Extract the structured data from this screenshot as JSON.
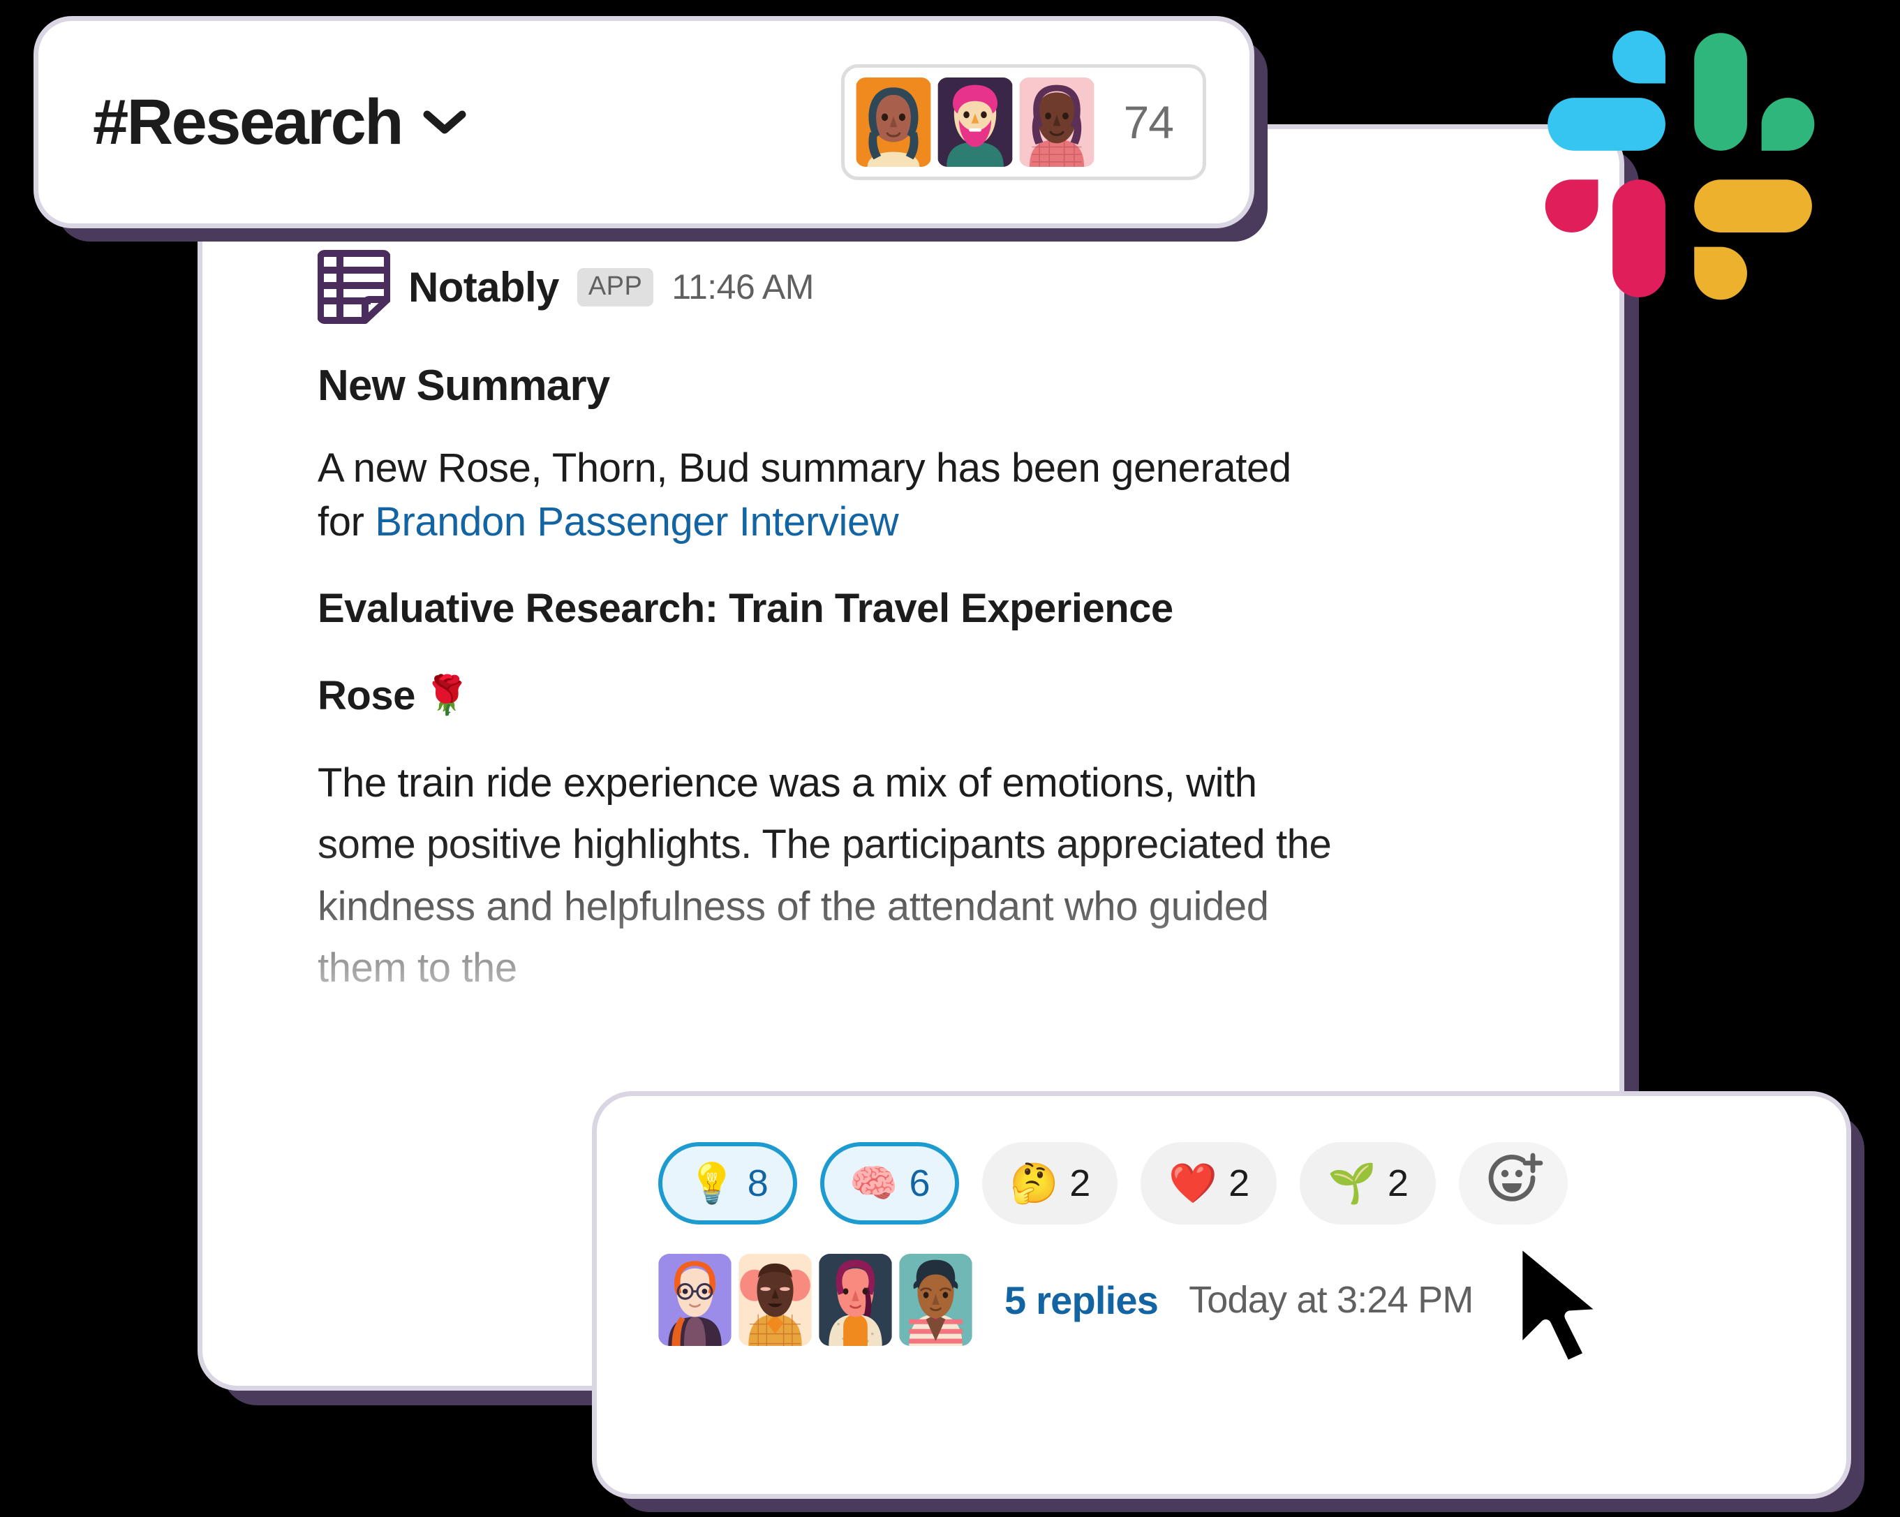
{
  "channel_header": {
    "name": "#Research",
    "chevron_icon": "chevron-down-icon",
    "member_count": "74",
    "member_avatars": [
      {
        "name": "member-avatar-1",
        "bg": "#F08A1E"
      },
      {
        "name": "member-avatar-2",
        "bg": "#3A2647"
      },
      {
        "name": "member-avatar-3",
        "bg": "#F9C8CC"
      }
    ]
  },
  "message": {
    "app_icon": "notably-table-icon",
    "app_name": "Notably",
    "app_badge": "APP",
    "timestamp": "11:46 AM",
    "title": "New Summary",
    "body_prefix": "A new Rose, Thorn, Bud summary has been generated for ",
    "body_link": "Brandon Passenger Interview",
    "subtitle": "Evaluative Research: Train Travel Experience",
    "section_title": "Rose",
    "section_emoji": "🌹",
    "section_body": "The train ride experience was a mix of emotions, with some positive highlights. The participants appreciated the kindness and helpfulness of the attendant who guided them to the"
  },
  "reactions": [
    {
      "name": "reaction-lightbulb",
      "emoji": "💡",
      "count": "8",
      "selected": true
    },
    {
      "name": "reaction-brain",
      "emoji": "🧠",
      "count": "6",
      "selected": true
    },
    {
      "name": "reaction-thinking",
      "emoji": "🤔",
      "count": "2",
      "selected": false
    },
    {
      "name": "reaction-heart",
      "emoji": "❤️",
      "count": "2",
      "selected": false
    },
    {
      "name": "reaction-seedling",
      "emoji": "🌱",
      "count": "2",
      "selected": false
    }
  ],
  "add_reaction": {
    "name": "add-reaction-button",
    "icon": "smiley-plus-icon"
  },
  "thread": {
    "replies_label": "5 replies",
    "timestamp": "Today at 3:24 PM",
    "avatars": [
      {
        "name": "reply-avatar-1",
        "bg": "#9B8CEA"
      },
      {
        "name": "reply-avatar-2",
        "bg": "#FDE6CC"
      },
      {
        "name": "reply-avatar-3",
        "bg": "#2C3E50"
      },
      {
        "name": "reply-avatar-4",
        "bg": "#6FB8B5"
      }
    ]
  },
  "brand": {
    "logo": "slack-logo",
    "colors": {
      "cyan": "#36C5F0",
      "green": "#2EB67D",
      "crimson": "#E01E5A",
      "yellow": "#ECB22E",
      "link": "#1264A3",
      "selected_pill_border": "#1D9BD1",
      "selected_pill_bg": "#E8F5FD",
      "card_shadow": "#4A3A5C",
      "notably_purple": "#4A2D5C"
    }
  },
  "cursor": {
    "name": "mouse-cursor"
  }
}
